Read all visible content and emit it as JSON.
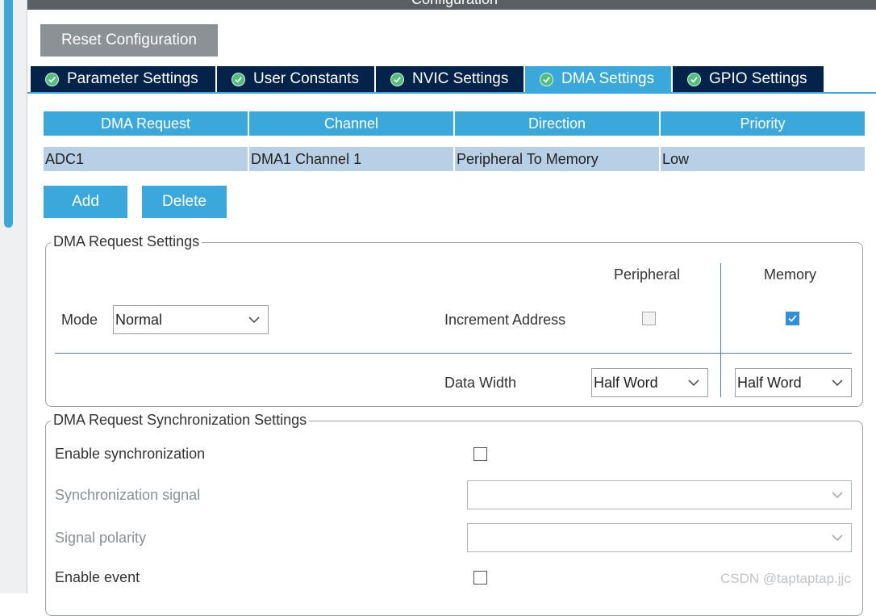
{
  "window": {
    "title": "Configuration"
  },
  "toolbar": {
    "reset_label": "Reset Configuration"
  },
  "tabs": [
    {
      "label": "Parameter Settings",
      "active": false
    },
    {
      "label": "User Constants",
      "active": false
    },
    {
      "label": "NVIC Settings",
      "active": false
    },
    {
      "label": "DMA Settings",
      "active": true
    },
    {
      "label": "GPIO Settings",
      "active": false
    }
  ],
  "dma_table": {
    "columns": [
      "DMA Request",
      "Channel",
      "Direction",
      "Priority"
    ],
    "rows": [
      [
        "ADC1",
        "DMA1 Channel 1",
        "Peripheral To Memory",
        "Low"
      ]
    ]
  },
  "actions": {
    "add_label": "Add",
    "delete_label": "Delete"
  },
  "request_settings": {
    "title": "DMA Request Settings",
    "mode_label": "Mode",
    "mode_value": "Normal",
    "peripheral_header": "Peripheral",
    "memory_header": "Memory",
    "increment_label": "Increment Address",
    "peripheral_increment": false,
    "memory_increment": true,
    "data_width_label": "Data Width",
    "peripheral_width": "Half Word",
    "memory_width": "Half Word"
  },
  "sync_settings": {
    "title": "DMA Request Synchronization Settings",
    "enable_sync_label": "Enable synchronization",
    "enable_sync": false,
    "sync_signal_label": "Synchronization signal",
    "sync_signal_value": "",
    "signal_polarity_label": "Signal polarity",
    "signal_polarity_value": "",
    "enable_event_label": "Enable event",
    "enable_event": false
  },
  "watermark": "CSDN @taptaptap.jjc",
  "colors": {
    "accent": "#3aa8db",
    "tab_dark": "#03234b",
    "row_selected": "#b8d0e6",
    "button_gray": "#8c9196"
  },
  "icons": {
    "tab_status": "check-circle-icon",
    "dropdown": "chevron-down-icon",
    "checkbox_checked": "checkmark-icon"
  }
}
